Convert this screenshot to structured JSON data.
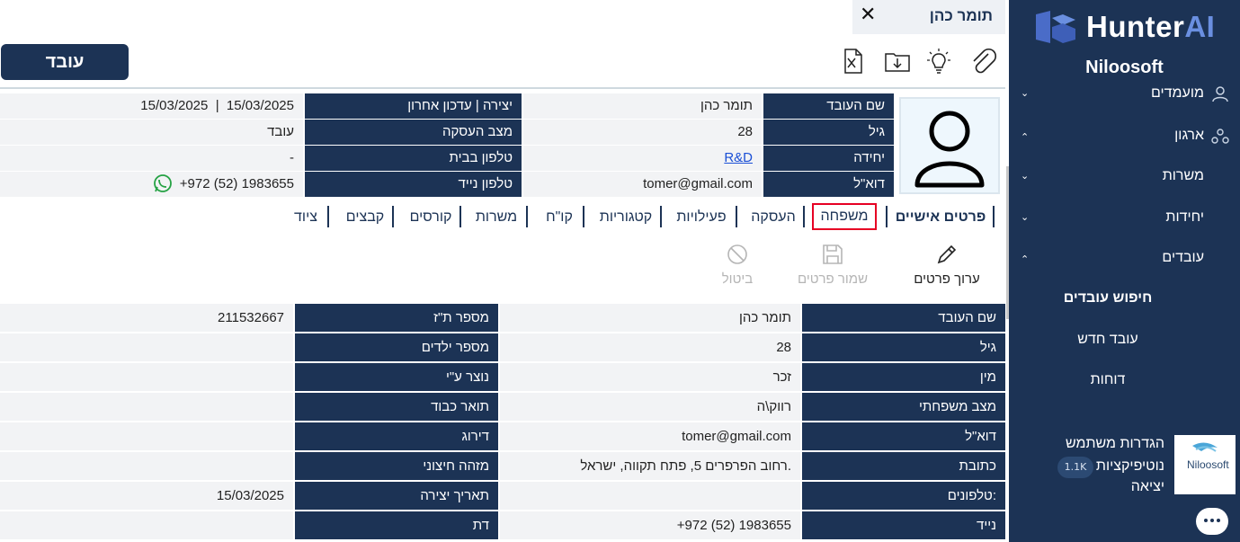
{
  "sidebar": {
    "logo_text": "HunterAI",
    "org_name": "Niloosoft",
    "items": [
      {
        "label": "מועמדים"
      },
      {
        "label": "ארגון"
      },
      {
        "label": "משרות"
      },
      {
        "label": "יחידות"
      },
      {
        "label": "עובדים"
      }
    ],
    "sub_items": [
      {
        "label": "חיפוש עובדים"
      },
      {
        "label": "עובד חדש"
      },
      {
        "label": "דוחות"
      }
    ],
    "user_menu": {
      "settings": "הגדרות משתמש",
      "notifications": "נוטיפיקציות",
      "notifications_badge": "1.1K",
      "logout": "יציאה",
      "user_logo_text": "Niloosoft"
    }
  },
  "header": {
    "name_tab_label": "תומר כהן",
    "employee_button": "עובד"
  },
  "summary": {
    "rows": [
      {
        "label_r": "שם העובד",
        "value_r": "תומר כהן",
        "label_l": "יצירה | עדכון אחרון",
        "value_l": "15/03/2025  |  15/03/2025"
      },
      {
        "label_r": "גיל",
        "value_r": "28",
        "label_l": "מצב העסקה",
        "value_l": "עובד"
      },
      {
        "label_r": "יחידה",
        "value_r": "R&D",
        "label_l": "טלפון בבית",
        "value_l": "-"
      },
      {
        "label_r": "דוא\"ל",
        "value_r": "tomer@gmail.com",
        "label_l": "טלפון נייד",
        "value_l": "+972 (52) 1983655"
      }
    ]
  },
  "tabs": [
    {
      "label": "פרטים אישיים"
    },
    {
      "label": "משפחה"
    },
    {
      "label": "העסקה"
    },
    {
      "label": "פעילויות"
    },
    {
      "label": "קטגוריות"
    },
    {
      "label": "קו\"ח"
    },
    {
      "label": "משרות"
    },
    {
      "label": "קורסים"
    },
    {
      "label": "קבצים"
    },
    {
      "label": "ציוד"
    }
  ],
  "actions": {
    "edit": "ערוך פרטים",
    "save": "שמור פרטים",
    "cancel": "ביטול"
  },
  "details": {
    "rows": [
      {
        "label_r": "שם העובד",
        "value_r": "תומר כהן",
        "label_l": "מספר ת\"ז",
        "value_l": "211532667"
      },
      {
        "label_r": "גיל",
        "value_r": "28",
        "label_l": "מספר ילדים",
        "value_l": ""
      },
      {
        "label_r": "מין",
        "value_r": "זכר",
        "label_l": "נוצר ע\"י",
        "value_l": ""
      },
      {
        "label_r": "מצב משפחתי",
        "value_r": "רווק\\ה",
        "label_l": "תואר כבוד",
        "value_l": ""
      },
      {
        "label_r": "דוא\"ל",
        "value_r": "tomer@gmail.com",
        "label_l": "דירוג",
        "value_l": ""
      },
      {
        "label_r": "כתובת",
        "value_r": "רחוב הפרפרים 5, פתח תקווה, ישראל.",
        "label_l": "מזהה חיצוני",
        "value_l": ""
      },
      {
        "label_r": "טלפונים:",
        "value_r": "",
        "label_l": "תאריך יצירה",
        "value_l": "15/03/2025"
      },
      {
        "label_r": "נייד",
        "value_r": "+972 (52) 1983655",
        "label_l": "דת",
        "value_l": ""
      }
    ]
  },
  "colors": {
    "primary": "#1c3355",
    "highlight": "#e60023",
    "link": "#1a4fd6"
  }
}
